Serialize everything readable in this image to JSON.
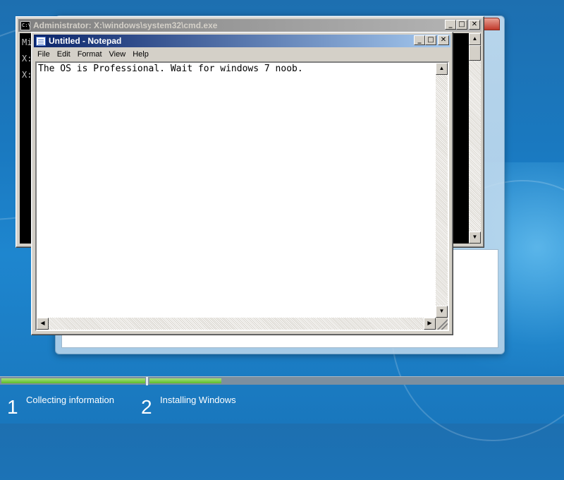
{
  "desktop": {
    "background_color": "#1a79c0"
  },
  "cmd_window": {
    "title": "Administrator: X:\\windows\\system32\\cmd.exe",
    "icon": "cmd-icon",
    "lines": [
      "Mi",
      "X:",
      "X:"
    ]
  },
  "notepad_window": {
    "title": "Untitled - Notepad",
    "icon": "notepad-icon",
    "menu": [
      "File",
      "Edit",
      "Format",
      "View",
      "Help"
    ],
    "content": "The OS is Professional. Wait for windows 7 noob."
  },
  "window_buttons": {
    "minimize": "_",
    "maximize": "□",
    "close": "✕"
  },
  "setup_progress": {
    "steps": [
      {
        "number": "1",
        "label": "Collecting information"
      },
      {
        "number": "2",
        "label": "Installing Windows"
      }
    ],
    "accent_color": "#5dbd2a"
  }
}
